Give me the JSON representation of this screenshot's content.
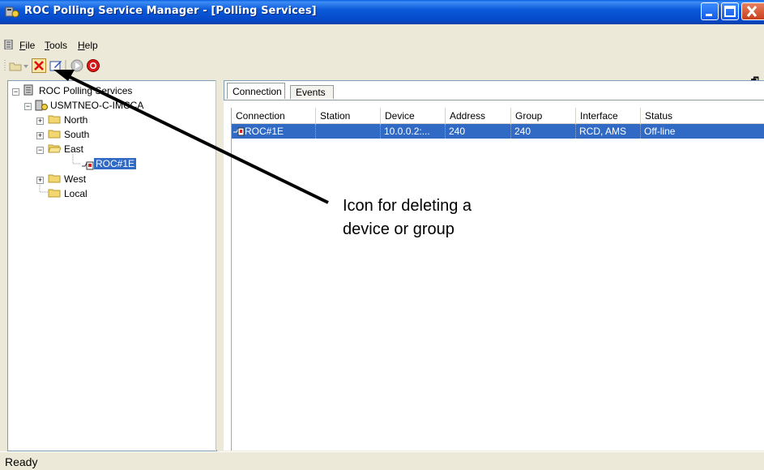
{
  "window": {
    "title": "ROC Polling Service Manager - [Polling Services]",
    "title_icon": "app-icon",
    "colors": {
      "title_bar": "#0b5ad9",
      "selection": "#316ac5",
      "close_button": "#c8401c"
    }
  },
  "menu": {
    "items": [
      "File",
      "Tools",
      "Help"
    ],
    "mdi_restore": "🗗"
  },
  "toolbar": {
    "buttons": [
      "open-folder-icon",
      "dropdown-arrow-icon",
      "delete-icon",
      "edit-icon",
      "start-icon",
      "stop-icon"
    ]
  },
  "tree": {
    "root": "ROC Polling Services",
    "server": "USMTNEO-C-IMCCA",
    "folders": [
      "North",
      "South",
      "East",
      "West",
      "Local"
    ],
    "device": "ROC#1E"
  },
  "tabs": [
    "Connection",
    "Events"
  ],
  "table": {
    "columns": [
      "Connection",
      "Station",
      "Device",
      "Address",
      "Group",
      "Interface",
      "Status"
    ],
    "rows": [
      {
        "connection": "ROC#1E",
        "station": "",
        "device": "10.0.0.2:...",
        "address": "240",
        "group": "240",
        "interface": "RCD, AMS",
        "status": "Off-line"
      }
    ]
  },
  "status": {
    "text": "Ready"
  },
  "callout": {
    "text": "Icon for deleting a\ndevice or group"
  }
}
